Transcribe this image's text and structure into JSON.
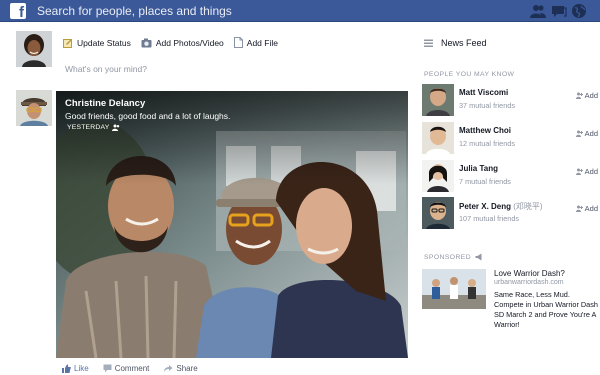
{
  "topbar": {
    "logo_letter": "f",
    "search_placeholder": "Search for people, places and things",
    "icons": [
      "friend-requests-icon",
      "messages-icon",
      "notifications-globe-icon"
    ]
  },
  "composer": {
    "tabs": [
      {
        "label": "Update Status",
        "icon": "update-status-icon"
      },
      {
        "label": "Add Photos/Video",
        "icon": "camera-icon"
      },
      {
        "label": "Add File",
        "icon": "file-icon"
      }
    ],
    "placeholder": "What's on your mind?"
  },
  "post": {
    "author": "Christine Delancy",
    "text": "Good friends, good food and a lot of laughs.",
    "time": "YESTERDAY",
    "actions": [
      "Like",
      "Comment",
      "Share"
    ]
  },
  "sidebar": {
    "news_feed_label": "News Feed",
    "pymk_header": "PEOPLE YOU MAY KNOW",
    "people": [
      {
        "name": "Matt Viscomi",
        "mutual": "37 mutual friends",
        "add": "Add"
      },
      {
        "name": "Matthew Choi",
        "mutual": "12 mutual friends",
        "add": "Add"
      },
      {
        "name": "Julia Tang",
        "mutual": "7 mutual friends",
        "add": "Add"
      },
      {
        "name": "Peter X. Deng",
        "alt_name": "(邓晓平)",
        "mutual": "107 mutual friends",
        "add": "Add"
      }
    ],
    "sponsored_label": "SPONSORED",
    "ad": {
      "title": "Love Warrior Dash?",
      "url": "urbanwarriordash.com",
      "body": "Same Race, Less Mud. Compete in Urban Warrior Dash SD March 2 and Prove You're A Warrior!"
    }
  },
  "colors": {
    "brand": "#3b5998",
    "link": "#5b74a8",
    "muted": "#9197a3"
  }
}
